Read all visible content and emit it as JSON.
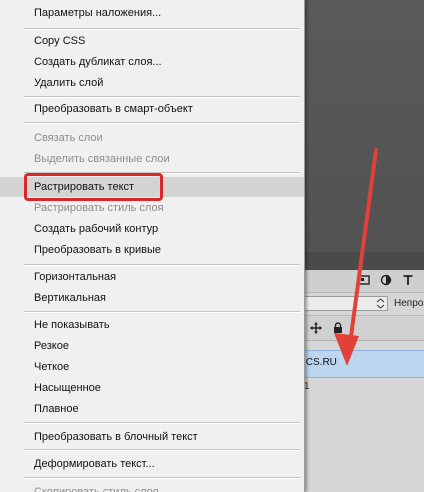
{
  "menu": {
    "items": [
      {
        "label": "Параметры наложения...",
        "enabled": true
      },
      {
        "label": "Copy CSS",
        "enabled": true
      },
      {
        "label": "Создать дубликат слоя...",
        "enabled": true
      },
      {
        "label": "Удалить слой",
        "enabled": true
      },
      {
        "label": "Преобразовать в смарт-объект",
        "enabled": true
      },
      {
        "label": "Связать слои",
        "enabled": false
      },
      {
        "label": "Выделить связанные слои",
        "enabled": false
      },
      {
        "label": "Растрировать текст",
        "enabled": true,
        "highlighted": true
      },
      {
        "label": "Растрировать стиль слоя",
        "enabled": false
      },
      {
        "label": "Создать рабочий контур",
        "enabled": true
      },
      {
        "label": "Преобразовать в кривые",
        "enabled": true
      },
      {
        "label": "Горизонтальная",
        "enabled": true
      },
      {
        "label": "Вертикальная",
        "enabled": true
      },
      {
        "label": "Не показывать",
        "enabled": true
      },
      {
        "label": "Резкое",
        "enabled": true
      },
      {
        "label": "Четкое",
        "enabled": true
      },
      {
        "label": "Насыщенное",
        "enabled": true
      },
      {
        "label": "Плавное",
        "enabled": true
      },
      {
        "label": "Преобразовать в блочный текст",
        "enabled": true
      },
      {
        "label": "Деформировать текст...",
        "enabled": true
      },
      {
        "label": "Скопировать стиль слоя",
        "enabled": false
      }
    ]
  },
  "layers_panel": {
    "opacity_label": "Непрозр",
    "layer_name": "ICS.RU",
    "second_row_text": "1"
  },
  "colors": {
    "highlight_outline": "#d8282b",
    "arrow": "#e2413a",
    "selected_layer": "#bdd5ee"
  },
  "icons": [
    "image-icon",
    "circle-half-icon",
    "text-icon",
    "move-icon",
    "lock-icon",
    "dropdown-arrow-icon"
  ]
}
